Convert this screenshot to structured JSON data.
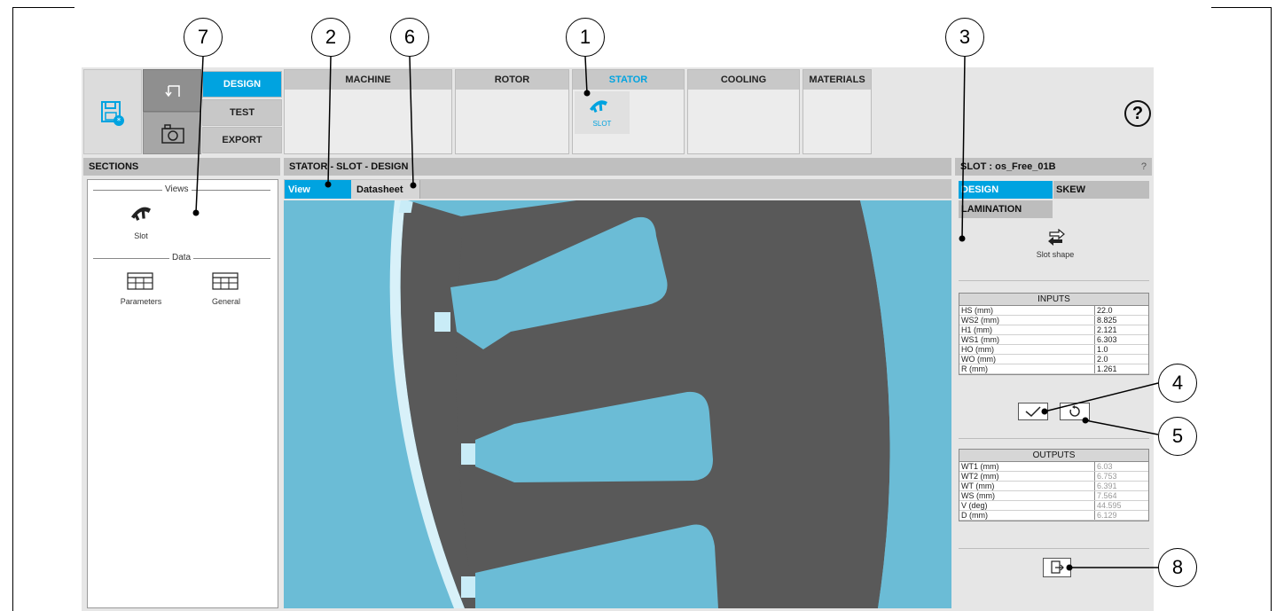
{
  "callouts": [
    "7",
    "2",
    "6",
    "1",
    "3",
    "4",
    "5",
    "8"
  ],
  "modes": {
    "design": "DESIGN",
    "test": "TEST",
    "export": "EXPORT"
  },
  "tabs": {
    "machine": "MACHINE",
    "rotor": "ROTOR",
    "stator": "STATOR",
    "cooling": "COOLING",
    "materials": "MATERIALS",
    "slot": "SLOT"
  },
  "help": "?",
  "sections": {
    "title": "SECTIONS",
    "views_label": "Views",
    "slot_label": "Slot",
    "data_label": "Data",
    "parameters_label": "Parameters",
    "general_label": "General"
  },
  "center": {
    "title": "STATOR - SLOT - DESIGN",
    "view_tab": "View",
    "datasheet_tab": "Datasheet"
  },
  "right": {
    "title": "SLOT : os_Free_01B",
    "help": "?",
    "tab_design": "DESIGN",
    "tab_skew": "SKEW",
    "tab_lamination": "LAMINATION",
    "slot_shape": "Slot shape",
    "inputs_title": "INPUTS",
    "inputs": [
      {
        "k": "HS (mm)",
        "v": "22.0"
      },
      {
        "k": "WS2 (mm)",
        "v": "8.825"
      },
      {
        "k": "H1 (mm)",
        "v": "2.121"
      },
      {
        "k": "WS1 (mm)",
        "v": "6.303"
      },
      {
        "k": "HO (mm)",
        "v": "1.0"
      },
      {
        "k": "WO (mm)",
        "v": "2.0"
      },
      {
        "k": "R (mm)",
        "v": "1.261"
      }
    ],
    "outputs_title": "OUTPUTS",
    "outputs": [
      {
        "k": "WT1 (mm)",
        "v": "6.03"
      },
      {
        "k": "WT2 (mm)",
        "v": "6.753"
      },
      {
        "k": "WT (mm)",
        "v": "6.391"
      },
      {
        "k": "WS (mm)",
        "v": "7.564"
      },
      {
        "k": "V (deg)",
        "v": "44.595"
      },
      {
        "k": "D (mm)",
        "v": "6.129"
      }
    ]
  },
  "colors": {
    "accent": "#00a3e0",
    "slot_fill": "#6bbcd6",
    "iron": "#595959",
    "wedge": "#c9ecf7"
  }
}
